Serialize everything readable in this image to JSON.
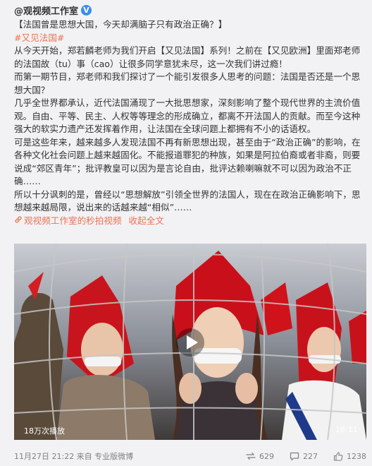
{
  "author": {
    "name": "@观视频工作室",
    "verified_badge": "V"
  },
  "post": {
    "headline": "【法国曾是思想大国，今天却满脑子只有政治正确？】",
    "hashtag": "#又见法国#",
    "p1": "从今天开始，郑若麟老师为我们开启【又见法国】系列！之前在【又见欧洲】里面郑老师的法国故（tu）事（cao）让很多同学意犹未尽，这一次我们讲过瘾！",
    "p2": "而第一期节目，郑老师和我们探讨了一个能引发很多人思考的问题：法国是否还是一个思想大国？",
    "p3": "几乎全世界都承认，近代法国涌现了一大批思想家，深刻影响了整个现代世界的主流价值观。自由、平等、民主、人权等等理念的形成确立，都离不开法国人的贡献。而至今这种强大的软实力遗产还发挥着作用，让法国在全球问题上都拥有不小的话语权。",
    "p4": "可是这些年来，越来越多人发现法国不再有新思想出现，甚至由于“政治正确”的影响，在各种文化社会问题上越来越固化。不能报道罪犯的种族，如果是阿拉伯裔或者非裔，则要说成“郊区青年”；批评教皇可以因为是言论自由，批评达赖喇嘛就不可以因为政治不正确……",
    "p5": "所以十分讽刺的是，曾经以“思想解放”引领全世界的法国人，现在在政治正确影响下，思想越来越局限，说出来的话越来越“相似”……",
    "video_link": "观视频工作室的秒拍视频",
    "collapse": "收起全文"
  },
  "video": {
    "play_count": "18万次播放",
    "duration": "16:11"
  },
  "footer": {
    "time_source": "11月27日 21:22 来自 专业版微博",
    "reposts": "629",
    "comments": "227",
    "likes": "1238"
  },
  "icons": {
    "repost": "repost-icon",
    "comment": "comment-icon",
    "like": "thumbs-up-icon",
    "link": "link-icon",
    "play": "play-icon"
  },
  "colors": {
    "link": "#eb7350",
    "verified": "#3b8ee8",
    "text": "#333333",
    "meta": "#808080"
  }
}
